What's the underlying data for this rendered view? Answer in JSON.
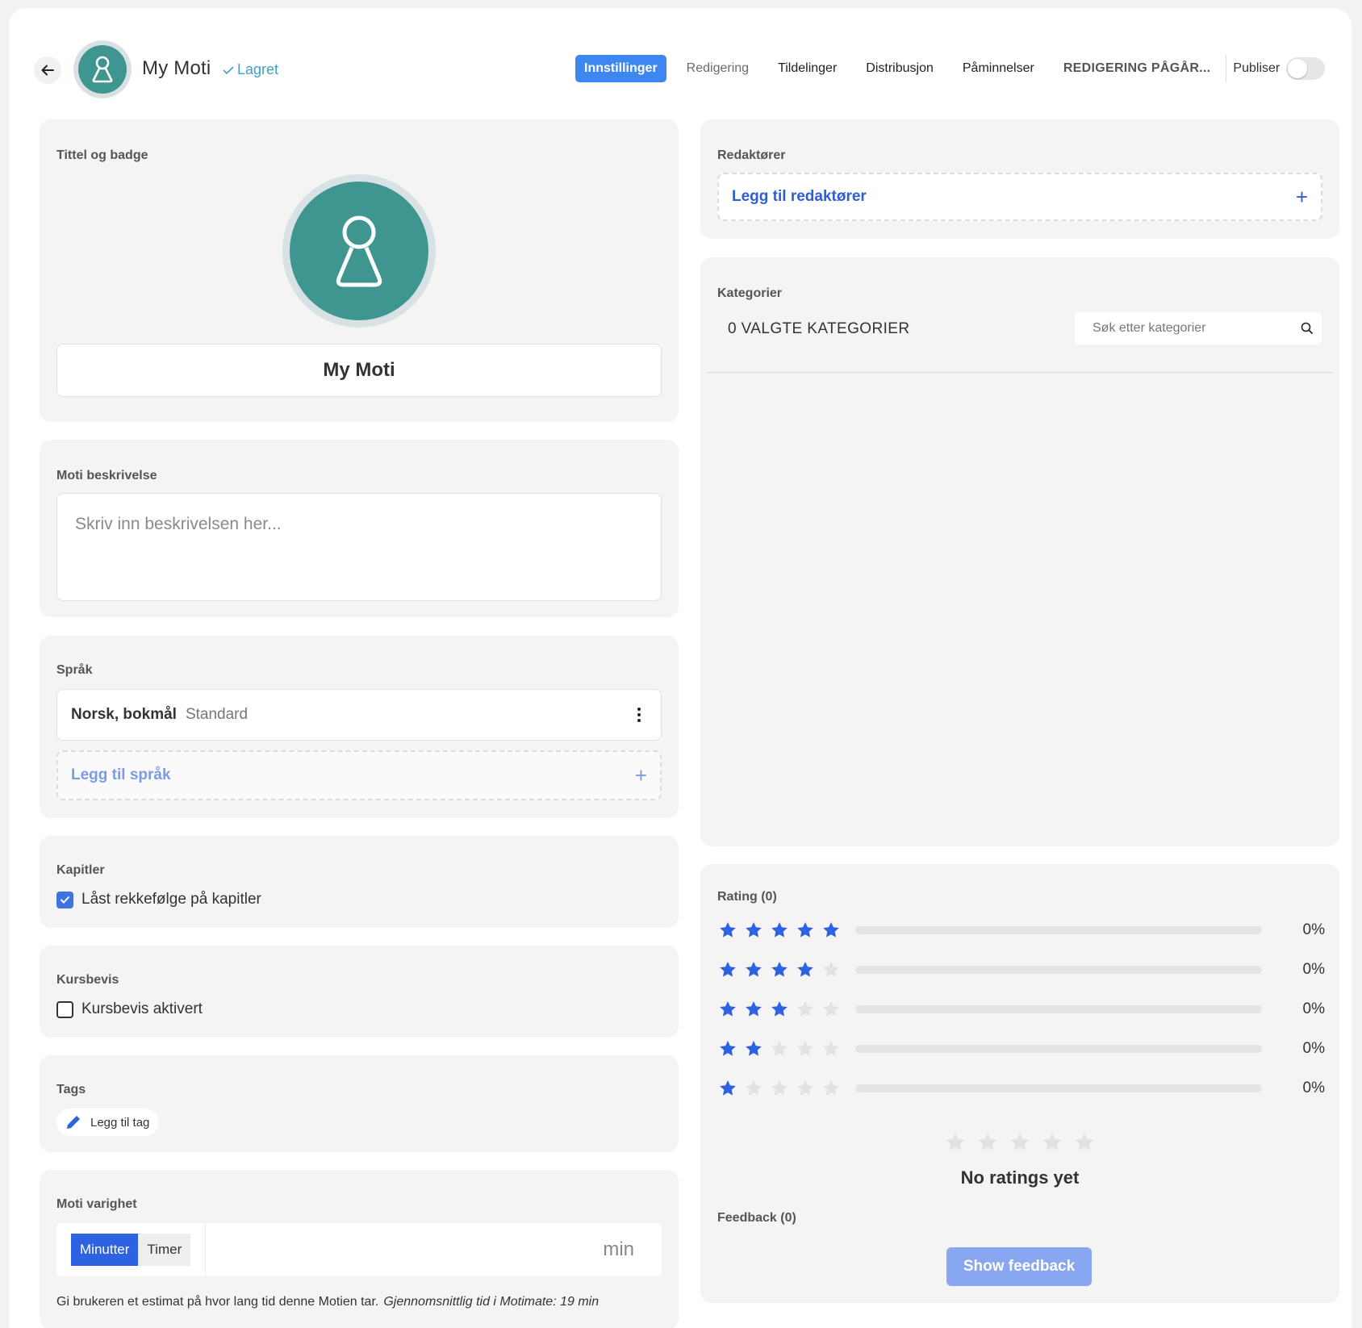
{
  "header": {
    "title": "My Moti",
    "saved_label": "Lagret",
    "tabs": [
      {
        "label": "Innstillinger",
        "active": true
      },
      {
        "label": "Redigering"
      },
      {
        "label": "Tildelinger"
      },
      {
        "label": "Distribusjon"
      },
      {
        "label": "Påminnelser"
      }
    ],
    "status_label": "REDIGERING PÅGÅR...",
    "publish_label": "Publiser",
    "publish_enabled": false
  },
  "title_badge": {
    "section_title": "Tittel og badge",
    "title_value": "My Moti",
    "badge_color": "#3f9590"
  },
  "description": {
    "section_title": "Moti beskrivelse",
    "placeholder": "Skriv inn beskrivelsen her..."
  },
  "language": {
    "section_title": "Språk",
    "current_language": "Norsk, bokmål",
    "current_tag": "Standard",
    "add_label": "Legg til språk"
  },
  "chapters": {
    "section_title": "Kapitler",
    "locked_order_label": "Låst rekkefølge på kapitler",
    "locked_order_checked": true
  },
  "certificate": {
    "section_title": "Kursbevis",
    "enabled_label": "Kursbevis aktivert",
    "enabled_checked": false
  },
  "tags": {
    "section_title": "Tags",
    "add_label": "Legg til tag"
  },
  "duration": {
    "section_title": "Moti varighet",
    "unit_options": [
      "Minutter",
      "Timer"
    ],
    "selected_unit": "Minutter",
    "unit_suffix": "min",
    "hint": "Gi brukeren et estimat på hvor lang tid denne Motien tar.",
    "average_hint": "Gjennomsnittlig tid i Motimate: 19 min"
  },
  "editors": {
    "section_title": "Redaktører",
    "add_label": "Legg til redaktører"
  },
  "categories": {
    "section_title": "Kategorier",
    "selected_count_label": "0 VALGTE KATEGORIER",
    "search_placeholder": "Søk etter kategorier"
  },
  "rating": {
    "section_title": "Rating (0)",
    "rows": [
      {
        "stars": 5,
        "percent": 0,
        "label": "0%"
      },
      {
        "stars": 4,
        "percent": 0,
        "label": "0%"
      },
      {
        "stars": 3,
        "percent": 0,
        "label": "0%"
      },
      {
        "stars": 2,
        "percent": 0,
        "label": "0%"
      },
      {
        "stars": 1,
        "percent": 0,
        "label": "0%"
      }
    ],
    "empty_label": "No ratings yet",
    "feedback_title": "Feedback (0)",
    "show_feedback_label": "Show feedback",
    "star_color": "#2d62e0",
    "star_empty_color": "#e2e2e2"
  },
  "icons": {
    "back": "arrow-left-icon",
    "check": "check-icon",
    "plus": "plus-icon",
    "search": "search-icon",
    "pencil": "pencil-icon",
    "kebab": "kebab-menu-icon",
    "star": "star-icon"
  }
}
